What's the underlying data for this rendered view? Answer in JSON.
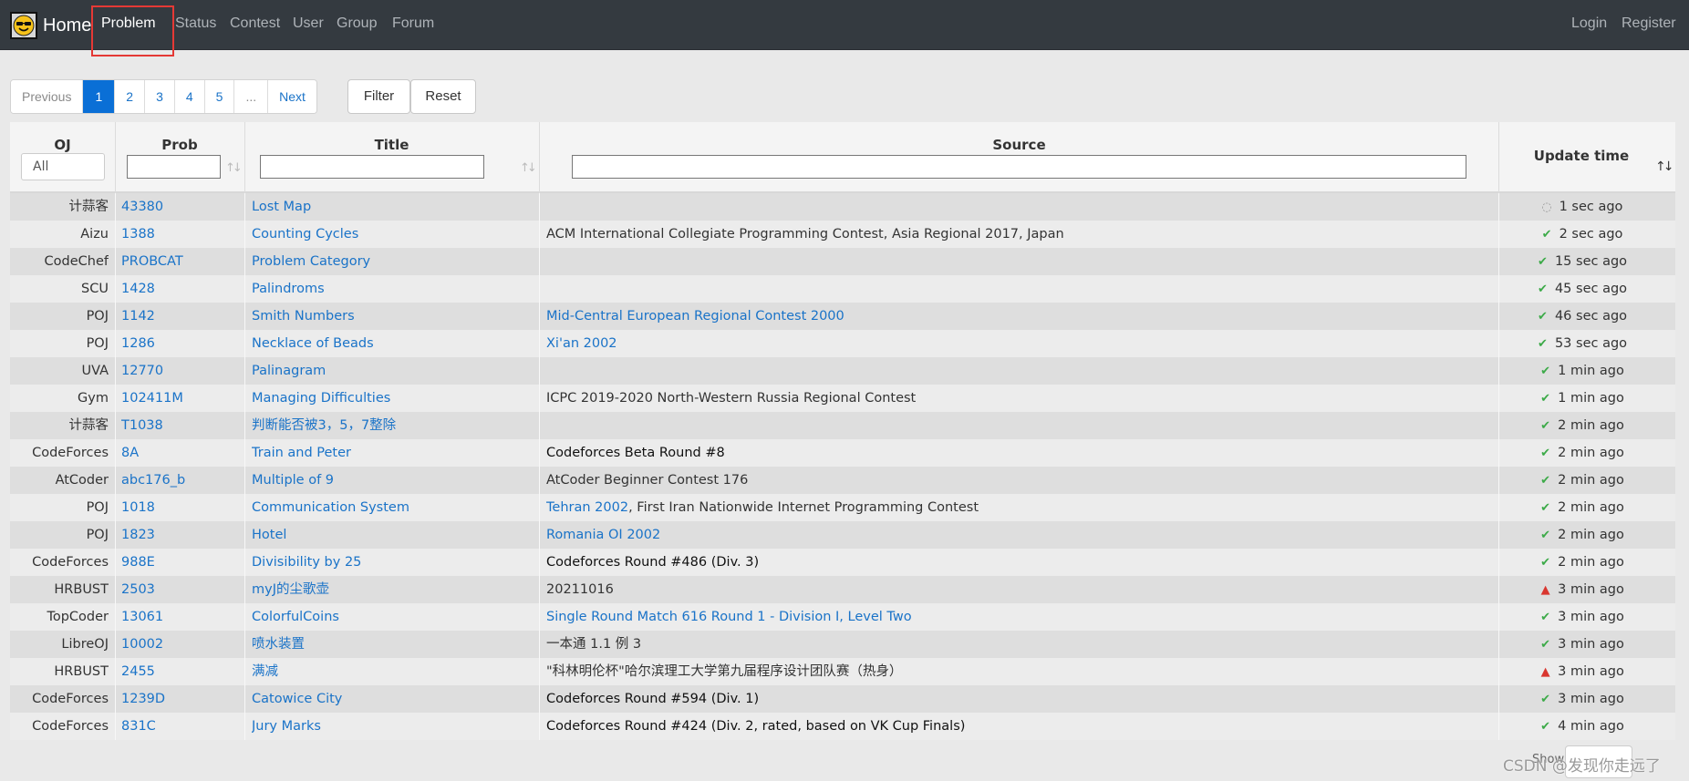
{
  "navbar": {
    "brand": "Home",
    "items": [
      "Problem",
      "Status",
      "Contest",
      "User",
      "Group",
      "Forum"
    ],
    "right": [
      "Login",
      "Register"
    ],
    "active": "Problem"
  },
  "pagination": {
    "previous": "Previous",
    "pages": [
      "1",
      "2",
      "3",
      "4",
      "5",
      "..."
    ],
    "next": "Next",
    "current": "1"
  },
  "toolbar": {
    "filter": "Filter",
    "reset": "Reset"
  },
  "table": {
    "headers": {
      "oj": "OJ",
      "prob": "Prob",
      "title": "Title",
      "source": "Source",
      "update": "Update time"
    },
    "oj_select": "All",
    "rows": [
      {
        "oj": "计蒜客",
        "prob": "43380",
        "title": "Lost Map",
        "source": [],
        "status": "pending",
        "time": "1 sec ago"
      },
      {
        "oj": "Aizu",
        "prob": "1388",
        "title": "Counting Cycles",
        "source": [
          {
            "text": "ACM International Collegiate Programming Contest, Asia Regional 2017, Japan",
            "style": "plain"
          }
        ],
        "status": "ok",
        "time": "2 sec ago"
      },
      {
        "oj": "CodeChef",
        "prob": "PROBCAT",
        "title": "Problem Category",
        "source": [],
        "status": "ok",
        "time": "15 sec ago"
      },
      {
        "oj": "SCU",
        "prob": "1428",
        "title": "Palindroms",
        "source": [],
        "status": "ok",
        "time": "45 sec ago"
      },
      {
        "oj": "POJ",
        "prob": "1142",
        "title": "Smith Numbers",
        "source": [
          {
            "text": "Mid-Central European Regional Contest 2000",
            "style": "link"
          }
        ],
        "status": "ok",
        "time": "46 sec ago"
      },
      {
        "oj": "POJ",
        "prob": "1286",
        "title": "Necklace of Beads",
        "source": [
          {
            "text": "Xi'an 2002",
            "style": "link"
          }
        ],
        "status": "ok",
        "time": "53 sec ago"
      },
      {
        "oj": "UVA",
        "prob": "12770",
        "title": "Palinagram",
        "source": [],
        "status": "ok",
        "time": "1 min ago"
      },
      {
        "oj": "Gym",
        "prob": "102411M",
        "title": "Managing Difficulties",
        "source": [
          {
            "text": "ICPC 2019-2020 North-Western Russia Regional Contest",
            "style": "plain"
          }
        ],
        "status": "ok",
        "time": "1 min ago"
      },
      {
        "oj": "计蒜客",
        "prob": "T1038",
        "title": "判断能否被3，5，7整除",
        "source": [],
        "status": "ok",
        "time": "2 min ago"
      },
      {
        "oj": "CodeForces",
        "prob": "8A",
        "title": "Train and Peter",
        "source": [
          {
            "text": "Codeforces Beta Round #8",
            "style": "dark"
          }
        ],
        "status": "ok",
        "time": "2 min ago"
      },
      {
        "oj": "AtCoder",
        "prob": "abc176_b",
        "title": "Multiple of 9",
        "source": [
          {
            "text": "AtCoder Beginner Contest 176",
            "style": "plain"
          }
        ],
        "status": "ok",
        "time": "2 min ago"
      },
      {
        "oj": "POJ",
        "prob": "1018",
        "title": "Communication System",
        "source": [
          {
            "text": "Tehran 2002",
            "style": "link"
          },
          {
            "text": ", First Iran Nationwide Internet Programming Contest",
            "style": "plain"
          }
        ],
        "status": "ok",
        "time": "2 min ago"
      },
      {
        "oj": "POJ",
        "prob": "1823",
        "title": "Hotel",
        "source": [
          {
            "text": "Romania OI 2002",
            "style": "link"
          }
        ],
        "status": "ok",
        "time": "2 min ago"
      },
      {
        "oj": "CodeForces",
        "prob": "988E",
        "title": "Divisibility by 25",
        "source": [
          {
            "text": "Codeforces Round #486 (Div. 3)",
            "style": "dark"
          }
        ],
        "status": "ok",
        "time": "2 min ago"
      },
      {
        "oj": "HRBUST",
        "prob": "2503",
        "title": "myJ的尘歌壶",
        "source": [
          {
            "text": "20211016",
            "style": "plain"
          }
        ],
        "status": "warn",
        "time": "3 min ago"
      },
      {
        "oj": "TopCoder",
        "prob": "13061",
        "title": "ColorfulCoins",
        "source": [
          {
            "text": "Single Round Match 616 Round 1 - Division I, Level Two",
            "style": "link"
          }
        ],
        "status": "ok",
        "time": "3 min ago"
      },
      {
        "oj": "LibreOJ",
        "prob": "10002",
        "title": "喷水装置",
        "source": [
          {
            "text": "一本通 1.1 例 3",
            "style": "plain"
          }
        ],
        "status": "ok",
        "time": "3 min ago"
      },
      {
        "oj": "HRBUST",
        "prob": "2455",
        "title": "满减",
        "source": [
          {
            "text": "\"科林明伦杯\"哈尔滨理工大学第九届程序设计团队赛（热身）",
            "style": "plain"
          }
        ],
        "status": "warn",
        "time": "3 min ago"
      },
      {
        "oj": "CodeForces",
        "prob": "1239D",
        "title": "Catowice City",
        "source": [
          {
            "text": "Codeforces Round #594 (Div. 1)",
            "style": "dark"
          }
        ],
        "status": "ok",
        "time": "3 min ago"
      },
      {
        "oj": "CodeForces",
        "prob": "831C",
        "title": "Jury Marks",
        "source": [
          {
            "text": "Codeforces Round #424 (Div. 2, rated, based on VK Cup Finals)",
            "style": "dark"
          }
        ],
        "status": "ok",
        "time": "4 min ago"
      }
    ]
  },
  "footer": {
    "show_label": "Show",
    "watermark": "CSDN @发现你走远了"
  },
  "colors": {
    "navbar": "#343a40",
    "link": "#1a73c8",
    "primary": "#0a6fd6",
    "ok": "#3caa48",
    "warn": "#d9362f",
    "highlight": "#e53935"
  }
}
